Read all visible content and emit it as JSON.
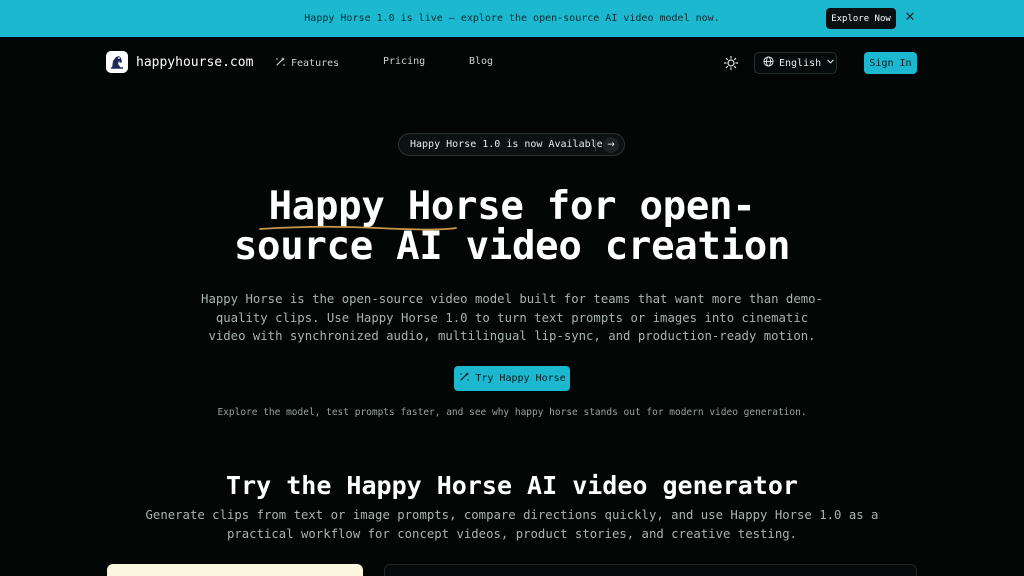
{
  "banner": {
    "text": "Happy Horse 1.0 is live — explore the open-source AI video model now.",
    "button_label": "Explore Now",
    "close_icon": "close-icon",
    "close_glyph": "✕"
  },
  "nav": {
    "logo_text": "happyhourse.com",
    "links": [
      {
        "label": "Features",
        "icon": "sparkles-icon"
      },
      {
        "label": "Pricing"
      },
      {
        "label": "Blog"
      }
    ],
    "theme_icon": "sun-icon",
    "language": {
      "label": "English",
      "icon": "globe-icon",
      "chevron": "chevron-down-icon"
    },
    "signin_label": "Sign In"
  },
  "hero": {
    "pill_text": "Happy Horse 1.0 is now Available",
    "pill_arrow": "→",
    "title_line1": "Happy Horse for open-",
    "title_line2": "source AI video creation",
    "description": "Happy Horse is the open-source video model built for teams that want more than demo-quality clips. Use Happy Horse 1.0 to turn text prompts or images into cinematic video with synchronized audio, multilingual lip-sync, and production-ready motion.",
    "cta_label": "Try Happy Horse",
    "cta_icon": "sparkles-icon",
    "subtext": "Explore the model, test prompts faster, and see why happy horse stands out for modern video generation."
  },
  "generator": {
    "title": "Try the Happy Horse AI video generator",
    "description": "Generate clips from text or image prompts, compare directions quickly, and use Happy Horse 1.0 as a practical workflow for concept videos, product stories, and creative testing."
  },
  "colors": {
    "accent": "#1bb8cf",
    "background": "#020605",
    "underline": "#c9974a"
  }
}
